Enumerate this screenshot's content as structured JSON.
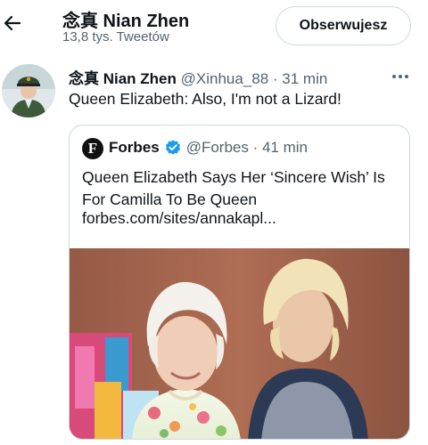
{
  "header": {
    "name": "念真 Nian Zhen",
    "tweet_count": "13,8 tys. Tweetów",
    "follow_label": "Obserwujesz"
  },
  "tweet": {
    "display_name": "念真 Nian Zhen",
    "handle_time": " @Xinhua_88 · 31 min",
    "text": "Queen Elizabeth: Also, I'm not a Lizard!"
  },
  "quote": {
    "logo_letter": "F",
    "name": "Forbes",
    "handle_time": "@Forbes · 41 min",
    "text": "Queen Elizabeth Says Her ‘Sincere Wish’ Is For Camilla To Be Queen",
    "link": "forbes.com/sites/annakapl..."
  },
  "icons": {
    "back": "arrow-left-icon",
    "more": "more-horizontal-icon",
    "verified": "verified-badge-icon"
  },
  "colors": {
    "text": "#0f1419",
    "muted": "#536471",
    "border": "#cfd9de",
    "verified": "#1d9bf0"
  }
}
